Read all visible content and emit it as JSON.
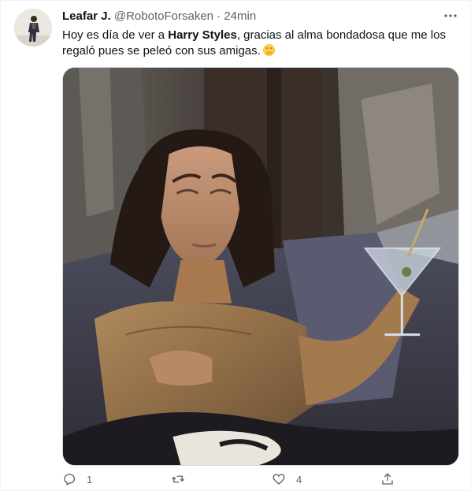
{
  "tweet": {
    "author_name": "Leafar J.",
    "author_handle": "@RobotoForsaken",
    "separator": "·",
    "timestamp": "24min",
    "text_before": "Hoy es día de ver a ",
    "text_bold": "Harry Styles",
    "text_after": ", gracias al alma bondadosa que me los regaló pues se peleó con sus amigas.",
    "emoji": "hand-over-mouth-emoji"
  },
  "actions": {
    "reply_count": "1",
    "retweet_count": "",
    "like_count": "4",
    "reply_icon": "reply-icon",
    "retweet_icon": "retweet-icon",
    "like_icon": "heart-icon",
    "share_icon": "share-icon"
  },
  "colors": {
    "text_primary": "#0f1419",
    "text_secondary": "#536471",
    "border": "#cfd9de"
  }
}
